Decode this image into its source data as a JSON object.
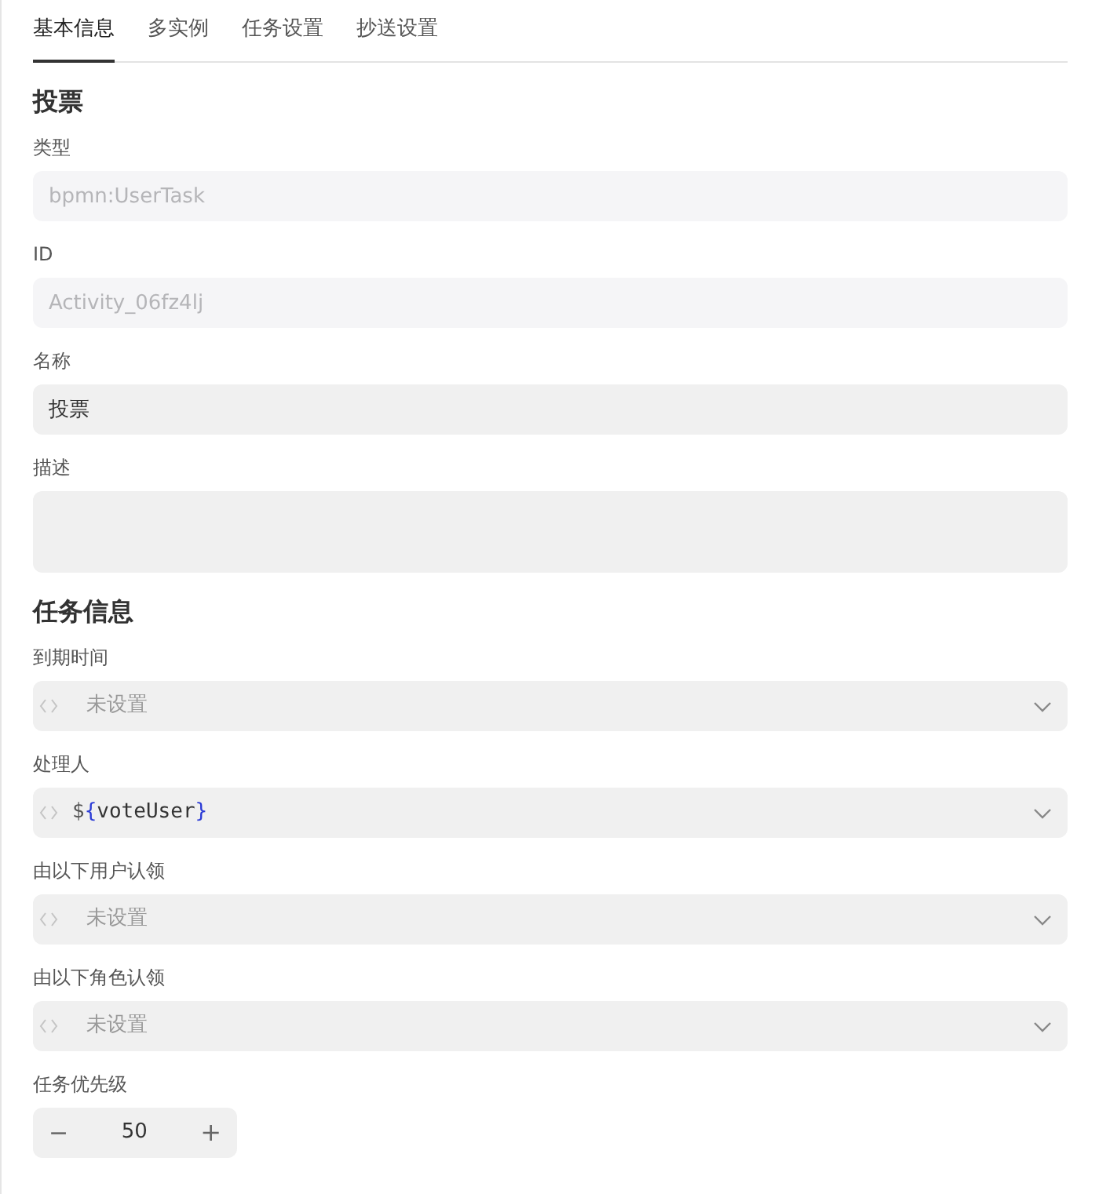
{
  "tabs": [
    {
      "label": "基本信息",
      "selected": true
    },
    {
      "label": "多实例",
      "selected": false
    },
    {
      "label": "任务设置",
      "selected": false
    },
    {
      "label": "抄送设置",
      "selected": false
    }
  ],
  "sections": [
    {
      "title": "投票",
      "fields": [
        {
          "kind": "text",
          "label": "类型",
          "value": "bpmn:UserTask",
          "disabled": true
        },
        {
          "kind": "text",
          "label": "ID",
          "value": "Activity_06fz4lj",
          "disabled": true
        },
        {
          "kind": "text",
          "label": "名称",
          "value": "投票",
          "disabled": false
        },
        {
          "kind": "textarea",
          "label": "描述"
        }
      ]
    },
    {
      "title": "任务信息",
      "fields": [
        {
          "kind": "expression",
          "label": "到期时间",
          "placeholder": "未设置"
        },
        {
          "kind": "expression",
          "label": "处理人",
          "value_parts": [
            {
              "kind": "symbol",
              "text": "$"
            },
            {
              "kind": "brace",
              "text": "{"
            },
            {
              "kind": "name",
              "text": "voteUser"
            },
            {
              "kind": "brace",
              "text": "}"
            }
          ]
        },
        {
          "kind": "expression",
          "label": "由以下用户认领",
          "placeholder": "未设置"
        },
        {
          "kind": "expression",
          "label": "由以下角色认领",
          "placeholder": "未设置"
        },
        {
          "kind": "stepper",
          "label": "任务优先级",
          "value": "50",
          "minus": "−",
          "plus": "+"
        }
      ]
    }
  ]
}
